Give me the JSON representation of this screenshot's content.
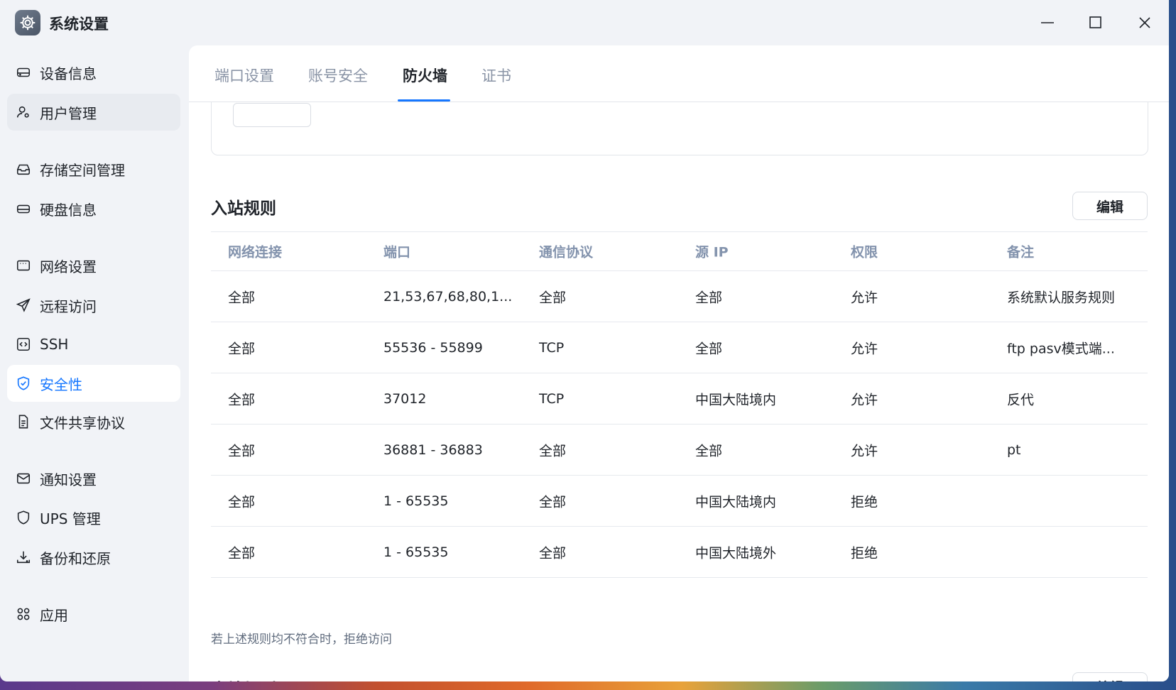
{
  "window": {
    "title": "系统设置"
  },
  "sidebar": {
    "items": [
      {
        "label": "设备信息",
        "icon": "device-icon"
      },
      {
        "label": "用户管理",
        "icon": "user-icon"
      },
      {
        "label": "存储空间管理",
        "icon": "storage-icon"
      },
      {
        "label": "硬盘信息",
        "icon": "disk-icon"
      },
      {
        "label": "网络设置",
        "icon": "network-icon"
      },
      {
        "label": "远程访问",
        "icon": "send-icon"
      },
      {
        "label": "SSH",
        "icon": "code-icon"
      },
      {
        "label": "安全性",
        "icon": "shield-check-icon"
      },
      {
        "label": "文件共享协议",
        "icon": "document-icon"
      },
      {
        "label": "通知设置",
        "icon": "mail-icon"
      },
      {
        "label": "UPS 管理",
        "icon": "shield-icon"
      },
      {
        "label": "备份和还原",
        "icon": "download-icon"
      },
      {
        "label": "应用",
        "icon": "apps-icon"
      }
    ],
    "active": "安全性"
  },
  "tabs": [
    "端口设置",
    "账号安全",
    "防火墙",
    "证书"
  ],
  "active_tab": "防火墙",
  "inbound": {
    "title": "入站规则",
    "edit_label": "编辑",
    "columns": [
      "网络连接",
      "端口",
      "通信协议",
      "源 IP",
      "权限",
      "备注"
    ],
    "rows": [
      [
        "全部",
        "21,53,67,68,80,1...",
        "全部",
        "全部",
        "允许",
        "系统默认服务规则"
      ],
      [
        "全部",
        "55536 - 55899",
        "TCP",
        "全部",
        "允许",
        "ftp pasv模式端..."
      ],
      [
        "全部",
        "37012",
        "TCP",
        "中国大陆境内",
        "允许",
        "反代"
      ],
      [
        "全部",
        "36881 - 36883",
        "全部",
        "全部",
        "允许",
        "pt"
      ],
      [
        "全部",
        "1 - 65535",
        "全部",
        "中国大陆境内",
        "拒绝",
        ""
      ],
      [
        "全部",
        "1 - 65535",
        "全部",
        "中国大陆境外",
        "拒绝",
        ""
      ]
    ],
    "footnote": "若上述规则均不符合时，拒绝访问"
  },
  "outbound": {
    "title": "出站规则",
    "edit_label": "编辑"
  },
  "colors": {
    "accent": "#1677ff",
    "sidebar_bg": "#f1f3f7",
    "header_text": "#8393ad"
  }
}
